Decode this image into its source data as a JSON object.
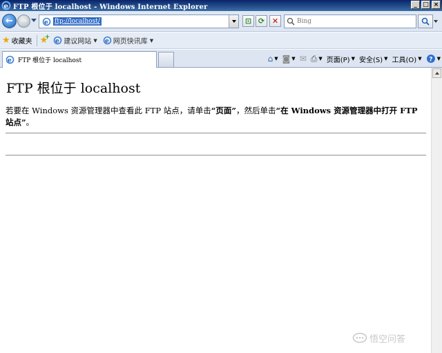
{
  "window": {
    "title": "FTP 根位于 localhost - Windows Internet Explorer",
    "controls": [
      "minimize",
      "maximize",
      "close"
    ]
  },
  "address_bar": {
    "url": "ftp://localhost/",
    "search_placeholder": "Bing"
  },
  "favorites_bar": {
    "label": "收藏夹",
    "links": [
      {
        "label": "建议网站",
        "icon": "ie-icon"
      },
      {
        "label": "网页快讯库",
        "icon": "ie-icon"
      }
    ]
  },
  "tabs": [
    {
      "title": "FTP 根位于 localhost",
      "active": true
    }
  ],
  "command_bar": {
    "page_label": "页面(P)",
    "safety_label": "安全(S)",
    "tools_label": "工具(O)"
  },
  "page": {
    "heading": "FTP 根位于 localhost",
    "instruction_part1": "若要在 Windows 资源管理器中查看此 FTP 站点，请单击",
    "instruction_bold1": "“页面”",
    "instruction_part2": "，然后单击",
    "instruction_bold2": "“在 Windows 资源管理器中打开 FTP 站点”",
    "instruction_part3": "。"
  },
  "watermark": {
    "text": "悟空问答"
  },
  "colors": {
    "titlebar": "#0a246a",
    "toolbar_bg": "#dfe7f3",
    "url_highlight": "#316ac5"
  }
}
